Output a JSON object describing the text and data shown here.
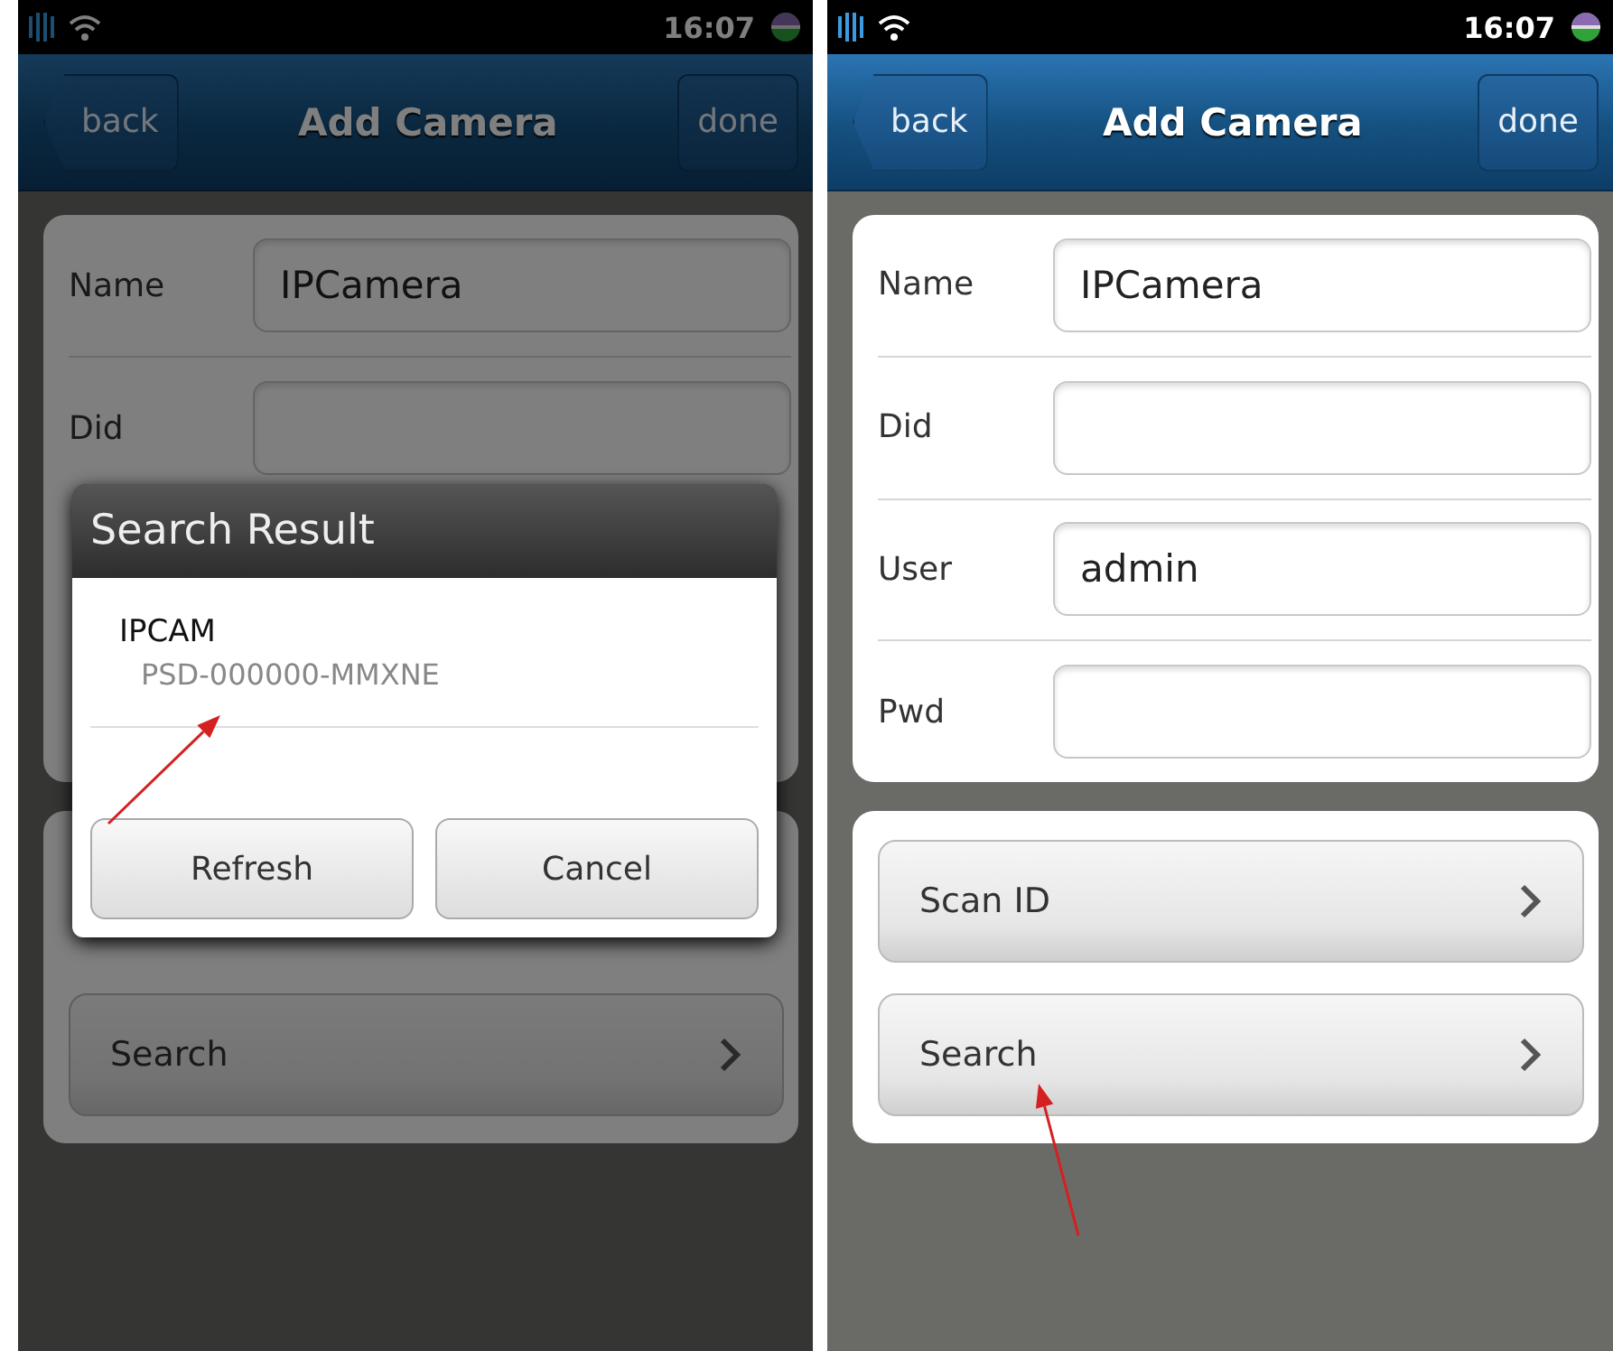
{
  "screens": [
    {
      "status_bar": {
        "time": "16:07"
      },
      "header": {
        "back": "back",
        "title": "Add Camera",
        "done": "done"
      },
      "form": [
        {
          "label": "Name",
          "value": "IPCamera"
        },
        {
          "label": "Did"
        }
      ],
      "actions": [
        {
          "label": "Search",
          "pointed": false
        }
      ],
      "dialog": {
        "title": "Search Result",
        "results": [
          {
            "name": "IPCAM",
            "id": "PSD-000000-MMXNE",
            "pointed": true
          }
        ],
        "buttons": [
          "Refresh",
          "Cancel"
        ]
      }
    },
    {
      "status_bar": {
        "time": "16:07"
      },
      "header": {
        "back": "back",
        "title": "Add Camera",
        "done": "done"
      },
      "form": [
        {
          "label": "Name",
          "value": "IPCamera"
        },
        {
          "label": "Did"
        },
        {
          "label": "User",
          "value": "admin"
        },
        {
          "label": "Pwd"
        }
      ],
      "actions": [
        {
          "label": "Scan ID",
          "pointed": false
        },
        {
          "label": "Search",
          "pointed": true
        }
      ]
    }
  ]
}
